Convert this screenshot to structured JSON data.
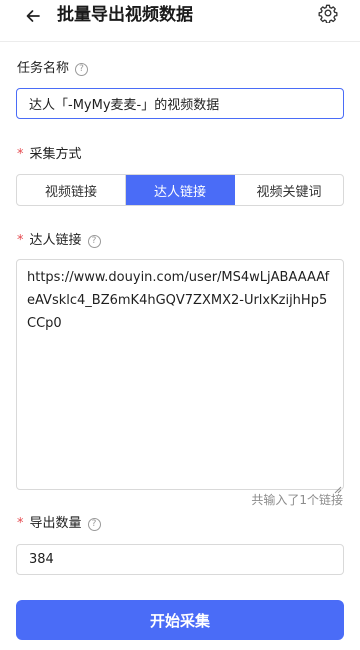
{
  "header": {
    "title": "批量导出视频数据",
    "back_icon": "arrow-left-icon",
    "settings_icon": "gear-icon"
  },
  "task_name": {
    "label": "任务名称",
    "help": "?",
    "value": "达人「-MyMy麦麦-」的视频数据"
  },
  "collect_mode": {
    "required": "*",
    "label": "采集方式",
    "options": [
      "视频链接",
      "达人链接",
      "视频关键词"
    ],
    "selected": "达人链接"
  },
  "creator_link": {
    "required": "*",
    "label": "达人链接",
    "help": "?",
    "value": "https://www.douyin.com/user/MS4wLjABAAAAfeAVsklc4_BZ6mK4hGQV7ZXMX2-UrlxKzijhHp5CCp0",
    "counter": "共输入了1个链接"
  },
  "export_count": {
    "required": "*",
    "label": "导出数量",
    "help": "?",
    "value": "384"
  },
  "actions": {
    "start_label": "开始采集"
  },
  "colors": {
    "accent": "#4a6cf7",
    "required": "#e5484d"
  }
}
